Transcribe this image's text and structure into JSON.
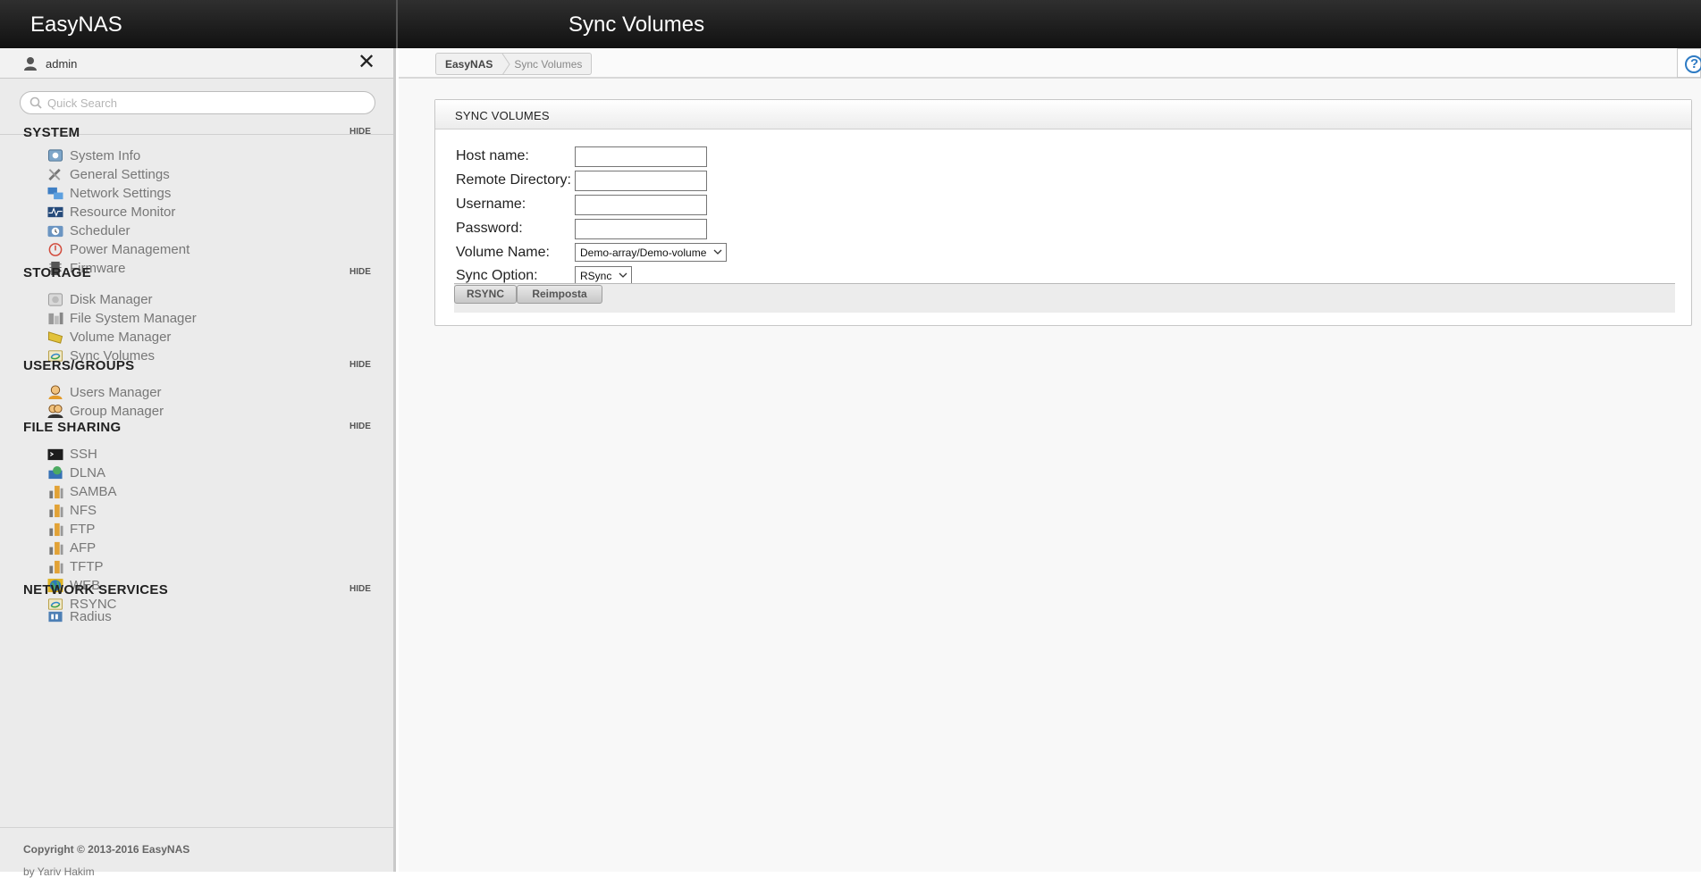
{
  "app": {
    "brand": "EasyNAS",
    "page_title": "Sync Volumes"
  },
  "user": {
    "name": "admin"
  },
  "search": {
    "placeholder": "Quick Search"
  },
  "sections": [
    {
      "title": "SYSTEM",
      "hide": "HIDE",
      "items": [
        {
          "label": "System Info",
          "icon": "system-info-icon"
        },
        {
          "label": "General Settings",
          "icon": "tools-icon"
        },
        {
          "label": "Network Settings",
          "icon": "network-icon"
        },
        {
          "label": "Resource Monitor",
          "icon": "monitor-icon"
        },
        {
          "label": "Scheduler",
          "icon": "clock-icon"
        },
        {
          "label": "Power Management",
          "icon": "power-icon"
        },
        {
          "label": "Firmware",
          "icon": "chip-icon"
        }
      ]
    },
    {
      "title": "STORAGE",
      "hide": "HIDE",
      "items": [
        {
          "label": "Disk Manager",
          "icon": "disk-icon"
        },
        {
          "label": "File System Manager",
          "icon": "filesystem-icon"
        },
        {
          "label": "Volume Manager",
          "icon": "volume-icon"
        },
        {
          "label": "Sync Volumes",
          "icon": "sync-icon"
        }
      ]
    },
    {
      "title": "USERS/GROUPS",
      "hide": "HIDE",
      "items": [
        {
          "label": "Users Manager",
          "icon": "user-icon"
        },
        {
          "label": "Group Manager",
          "icon": "group-icon"
        }
      ]
    },
    {
      "title": "FILE SHARING",
      "hide": "HIDE",
      "items": [
        {
          "label": "SSH",
          "icon": "terminal-icon"
        },
        {
          "label": "DLNA",
          "icon": "dlna-icon"
        },
        {
          "label": "SAMBA",
          "icon": "share-icon"
        },
        {
          "label": "NFS",
          "icon": "share-icon"
        },
        {
          "label": "FTP",
          "icon": "share-icon"
        },
        {
          "label": "AFP",
          "icon": "share-icon"
        },
        {
          "label": "TFTP",
          "icon": "share-icon"
        },
        {
          "label": "WEB",
          "icon": "globe-icon"
        },
        {
          "label": "RSYNC",
          "icon": "sync-icon"
        }
      ]
    },
    {
      "title": "NETWORK SERVICES",
      "hide": "HIDE",
      "items": [
        {
          "label": "Radius",
          "icon": "radius-icon"
        }
      ]
    }
  ],
  "footer": {
    "copyright": "Copyright © 2013-2016 EasyNAS",
    "author": "by Yariv Hakim"
  },
  "breadcrumb": {
    "root": "EasyNAS",
    "current": "Sync Volumes"
  },
  "panel": {
    "title": "SYNC VOLUMES",
    "fields": {
      "host_label": "Host name:",
      "host_value": "",
      "remote_label": "Remote Directory:",
      "remote_value": "",
      "username_label": "Username:",
      "username_value": "",
      "password_label": "Password:",
      "password_value": "",
      "volume_label": "Volume Name:",
      "volume_value": "Demo-array/Demo-volume",
      "option_label": "Sync Option:",
      "option_value": "RSync"
    },
    "buttons": {
      "submit": "RSYNC",
      "reset": "Reimposta"
    }
  },
  "colors": {
    "accent": "#2e7bc4",
    "topbar": "#1a1a1a",
    "sidebar": "#ebebeb"
  }
}
